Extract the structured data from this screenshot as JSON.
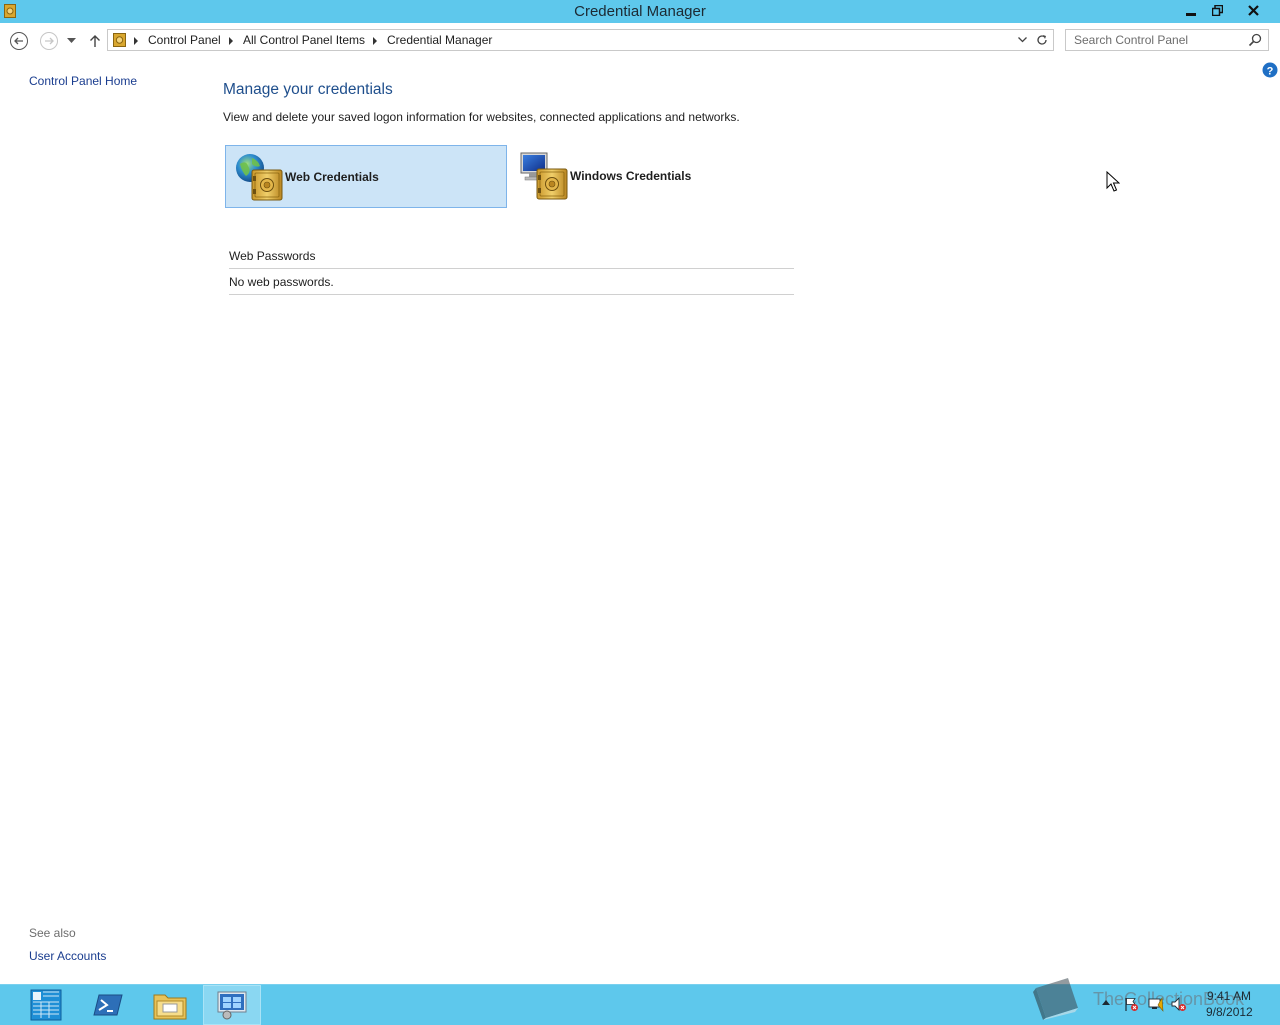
{
  "window": {
    "title": "Credential Manager",
    "buttons": [
      "minimize",
      "restore",
      "close"
    ]
  },
  "address_bar": {
    "breadcrumbs": [
      "Control Panel",
      "All Control Panel Items",
      "Credential Manager"
    ],
    "search_placeholder": "Search Control Panel"
  },
  "left_pane": {
    "home_link": "Control Panel Home",
    "see_also_label": "See also",
    "see_also_links": [
      "User Accounts"
    ]
  },
  "main": {
    "heading": "Manage your credentials",
    "description": "View and delete your saved logon information for websites, connected applications and networks.",
    "tiles": [
      {
        "label": "Web Credentials",
        "selected": true,
        "icon": "web-credentials-icon"
      },
      {
        "label": "Windows Credentials",
        "selected": false,
        "icon": "windows-credentials-icon"
      }
    ],
    "section_header": "Web Passwords",
    "empty_message": "No web passwords."
  },
  "taskbar": {
    "items": [
      "start-icon",
      "powershell-icon",
      "file-explorer-icon",
      "control-panel-icon"
    ],
    "active_item": "control-panel-icon",
    "watermark": "TheCollectionBook",
    "clock_time": "9:41 AM",
    "clock_date": "9/8/2012"
  },
  "colors": {
    "titlebar": "#5ec8ec",
    "link": "#1a3d8f",
    "heading": "#1e4e8c",
    "selected_tile": "#cce4f7"
  }
}
